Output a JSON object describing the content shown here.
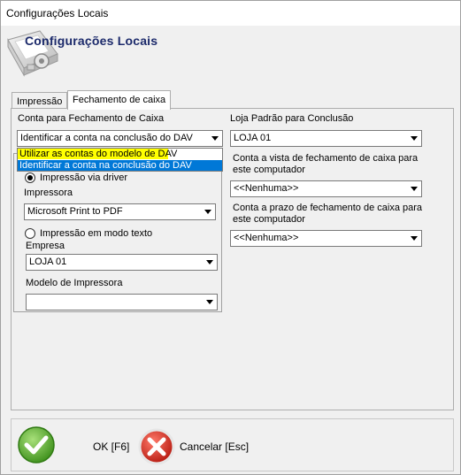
{
  "window": {
    "title": "Configurações Locais"
  },
  "header": {
    "title": "Configurações Locais",
    "icon": "settings-tablet-icon"
  },
  "tabs": [
    {
      "label": "Impressão",
      "active": false
    },
    {
      "label": "Fechamento de caixa",
      "active": true
    }
  ],
  "fechamento": {
    "conta_label": "Conta para Fechamento de Caixa",
    "conta_value": "Identificar a conta na conclusão do DAV",
    "dropdown_options": [
      "Utilizar as contas do modelo de DAV",
      "Identificar a conta na conclusão do DAV"
    ],
    "impressao_driver_label": "Impressão via driver",
    "impressora_label": "Impressora",
    "impressora_value": "Microsoft Print to PDF",
    "impressao_texto_label": "Impressão em modo texto",
    "empresa_label": "Empresa",
    "empresa_value": "LOJA 01",
    "modelo_label": "Modelo de Impressora",
    "modelo_value": ""
  },
  "loja": {
    "label": "Loja Padrão para Conclusão",
    "value": "LOJA 01",
    "vista_label_1": "Conta a vista de fechamento de caixa para",
    "vista_label_2": "este computador",
    "vista_value": "<<Nenhuma>>",
    "prazo_label_1": "Conta a prazo de fechamento de caixa para",
    "prazo_label_2": "este computador",
    "prazo_value": "<<Nenhuma>>"
  },
  "footer": {
    "ok_label": "OK [F6]",
    "cancel_label": "Cancelar [Esc]"
  },
  "colors": {
    "header_title": "#1c2a6b",
    "highlight_yellow": "#ffff00",
    "highlight_blue": "#0078d7",
    "ok_green": "#5cb531",
    "cancel_red": "#d9261c"
  }
}
